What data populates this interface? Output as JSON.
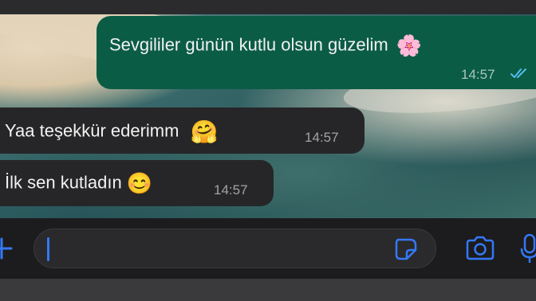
{
  "messages": {
    "outgoing": {
      "text": "Sevgililer günün kutlu olsun güzelim",
      "emoji": "🌸",
      "time": "14:57",
      "status": "read-double-check"
    },
    "incoming": [
      {
        "text": "Yaa teşekkür ederimm",
        "emoji": "🤗",
        "time": "14:57"
      },
      {
        "text": "İlk sen kutladın",
        "emoji": "😊",
        "time": "14:57"
      }
    ]
  },
  "composer": {
    "input_value": "",
    "icons": [
      "plus-icon",
      "sticker-icon",
      "camera-icon",
      "microphone-icon"
    ]
  },
  "colors": {
    "outgoing_bubble": "#0b5c45",
    "incoming_bubble": "#262628",
    "accent": "#3478f6",
    "read_ticks": "#53bdeb"
  }
}
